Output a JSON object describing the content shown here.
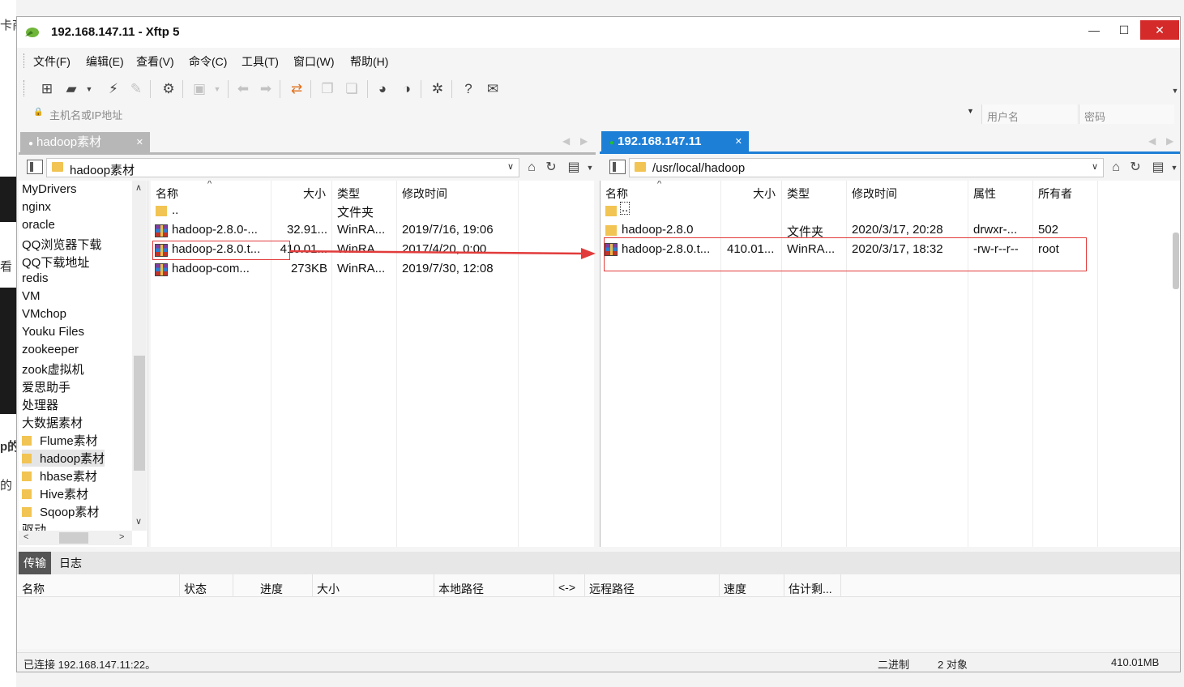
{
  "window": {
    "title": "192.168.147.11    - Xftp 5"
  },
  "menu": [
    "文件(F)",
    "编辑(E)",
    "查看(V)",
    "命令(C)",
    "工具(T)",
    "窗口(W)",
    "帮助(H)"
  ],
  "address": {
    "host_placeholder": "主机名或IP地址",
    "user_placeholder": "用户名",
    "password_placeholder": "密码"
  },
  "local": {
    "tab_label": "hadoop素材",
    "path": "hadoop素材",
    "tree": [
      "MyDrivers",
      "nginx",
      "oracle",
      "QQ浏览器下载",
      "QQ下载地址",
      "redis",
      "VM",
      "VMchop",
      "Youku Files",
      "zookeeper",
      "zook虚拟机",
      "爱思助手",
      "处理器",
      "大数据素材",
      "Flume素材",
      "hadoop素材",
      "hbase素材",
      "Hive素材",
      "Sqoop素材",
      "驱动"
    ],
    "columns": [
      "名称",
      "大小",
      "类型",
      "修改时间"
    ],
    "files": [
      {
        "name": "..",
        "size": "",
        "type": "文件夹",
        "modified": "",
        "icon": "folder-icon"
      },
      {
        "name": "hadoop-2.8.0-...",
        "size": "32.91...",
        "type": "WinRA...",
        "modified": "2019/7/16, 19:06",
        "icon": "rar-icon"
      },
      {
        "name": "hadoop-2.8.0.t...",
        "size": "410.01...",
        "type": "WinRA...",
        "modified": "2017/4/20, 0:00",
        "icon": "rar-icon"
      },
      {
        "name": "hadoop-com...",
        "size": "273KB",
        "type": "WinRA...",
        "modified": "2019/7/30, 12:08",
        "icon": "rar-icon"
      }
    ]
  },
  "remote": {
    "tab_label": "192.168.147.11",
    "path": "/usr/local/hadoop",
    "columns": [
      "名称",
      "大小",
      "类型",
      "修改时间",
      "属性",
      "所有者"
    ],
    "files": [
      {
        "name": "..",
        "size": "",
        "type": "",
        "modified": "",
        "attributes": "",
        "owner": "",
        "icon": "folder-icon"
      },
      {
        "name": "hadoop-2.8.0",
        "size": "",
        "type": "文件夹",
        "modified": "2020/3/17, 20:28",
        "attributes": "drwxr-...",
        "owner": "502",
        "icon": "folder-icon"
      },
      {
        "name": "hadoop-2.8.0.t...",
        "size": "410.01...",
        "type": "WinRA...",
        "modified": "2020/3/17, 18:32",
        "attributes": "-rw-r--r--",
        "owner": "root",
        "icon": "rar-icon"
      }
    ]
  },
  "transfer": {
    "tabs": [
      "传输",
      "日志"
    ],
    "columns": [
      "名称",
      "状态",
      "进度",
      "大小",
      "本地路径",
      "<->",
      "远程路径",
      "速度",
      "估计剩..."
    ]
  },
  "status": {
    "connection": "已连接 192.168.147.11:22。",
    "mode": "二进制",
    "objects": "2 对象",
    "size": "410.01MB"
  },
  "colors": {
    "remote_tab": "#1e7fd6",
    "close_button": "#d42a2a",
    "annotation": "#e23b3b"
  }
}
